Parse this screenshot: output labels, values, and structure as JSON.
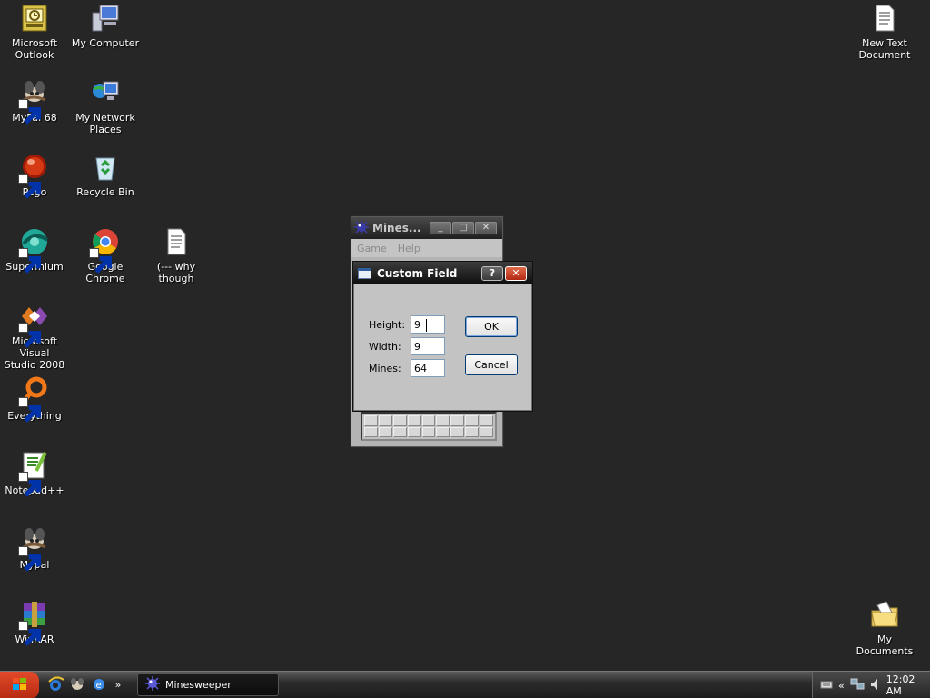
{
  "desktop": {
    "icons": [
      {
        "label": "Microsoft\nOutlook",
        "icon": "outlook-icon"
      },
      {
        "label": "My Computer",
        "icon": "my-computer-icon"
      },
      {
        "label": "MyPal 68",
        "icon": "mypal-icon"
      },
      {
        "label": "My Network\nPlaces",
        "icon": "network-places-icon"
      },
      {
        "label": "Pego",
        "icon": "pego-icon"
      },
      {
        "label": "Recycle Bin",
        "icon": "recycle-bin-icon"
      },
      {
        "label": "Supermium",
        "icon": "supermium-icon"
      },
      {
        "label": "Google Chrome",
        "icon": "chrome-icon"
      },
      {
        "label": "(--- why\nthough",
        "icon": "text-file-icon"
      },
      {
        "label": "Microsoft Visual\nStudio 2008",
        "icon": "visual-studio-icon"
      },
      {
        "label": "Everything",
        "icon": "everything-icon"
      },
      {
        "label": "Notepad++",
        "icon": "notepadpp-icon"
      },
      {
        "label": "Mypal",
        "icon": "mypal-icon"
      },
      {
        "label": "WinRAR",
        "icon": "winrar-icon"
      },
      {
        "label": "New Text\nDocument",
        "icon": "text-document-icon"
      },
      {
        "label": "My Documents",
        "icon": "my-documents-icon"
      }
    ]
  },
  "minesweeper": {
    "title": "Mines...",
    "menu": [
      "Game",
      "Help"
    ]
  },
  "dialog": {
    "title": "Custom Field",
    "help_label": "?",
    "close_label": "✕",
    "height_label": "Height:",
    "height_value": "9",
    "width_label": "Width:",
    "width_value": "9",
    "mines_label": "Mines:",
    "mines_value": "64",
    "ok_label": "OK",
    "cancel_label": "Cancel"
  },
  "taskbar": {
    "task_label": "Minesweeper",
    "quick_chevron": "»",
    "tray_chevron": "«",
    "clock": "12:02 AM"
  }
}
